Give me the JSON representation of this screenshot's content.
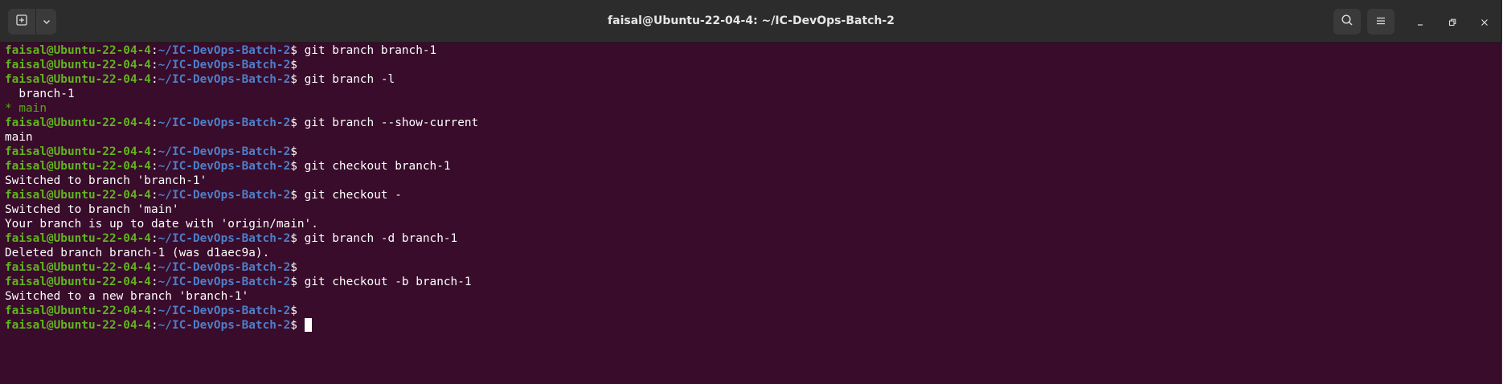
{
  "window": {
    "title": "faisal@Ubuntu-22-04-4: ~/IC-DevOps-Batch-2"
  },
  "titlebar": {
    "new_tab_icon": "new-tab-icon",
    "menu_dropdown_icon": "chevron-down-icon",
    "search_icon": "search-icon",
    "hamburger_icon": "hamburger-menu-icon",
    "minimize_icon": "minimize-icon",
    "maximize_icon": "maximize-icon",
    "close_icon": "close-icon"
  },
  "prompt": {
    "user_host": "faisal@Ubuntu-22-04-4",
    "colon": ":",
    "path": "~/IC-DevOps-Batch-2",
    "dollar": "$"
  },
  "colors": {
    "background": "#380c2a",
    "prompt_user": "#62b41f",
    "prompt_path": "#4f7ec8",
    "current_branch": "#5ea31c"
  },
  "lines": [
    {
      "type": "prompt",
      "command": " git branch branch-1"
    },
    {
      "type": "prompt",
      "command": ""
    },
    {
      "type": "prompt",
      "command": " git branch -l"
    },
    {
      "type": "output",
      "text": "  branch-1"
    },
    {
      "type": "output-green",
      "text": "* main"
    },
    {
      "type": "prompt",
      "command": " git branch --show-current"
    },
    {
      "type": "output",
      "text": "main"
    },
    {
      "type": "prompt",
      "command": ""
    },
    {
      "type": "prompt",
      "command": " git checkout branch-1"
    },
    {
      "type": "output",
      "text": "Switched to branch 'branch-1'"
    },
    {
      "type": "prompt",
      "command": " git checkout -"
    },
    {
      "type": "output",
      "text": "Switched to branch 'main'"
    },
    {
      "type": "output",
      "text": "Your branch is up to date with 'origin/main'."
    },
    {
      "type": "prompt",
      "command": " git branch -d branch-1"
    },
    {
      "type": "output",
      "text": "Deleted branch branch-1 (was d1aec9a)."
    },
    {
      "type": "prompt",
      "command": ""
    },
    {
      "type": "prompt",
      "command": " git checkout -b branch-1"
    },
    {
      "type": "output",
      "text": "Switched to a new branch 'branch-1'"
    },
    {
      "type": "prompt",
      "command": ""
    },
    {
      "type": "prompt-cursor",
      "command": " "
    }
  ]
}
